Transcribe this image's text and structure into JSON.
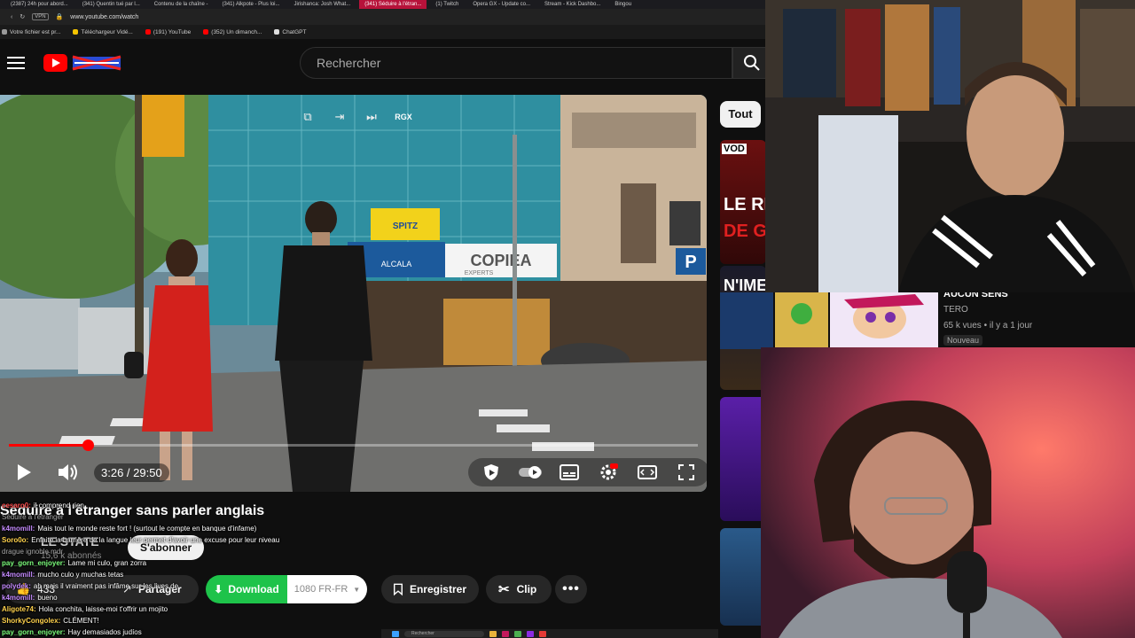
{
  "browser": {
    "tabs": [
      "(2387) 24h pour abord...",
      "(341) Quentin tué par l...",
      "Contenu de la chaîne -",
      "(341) Alkpote - Plus loi...",
      "Jirishanca: Josh What...",
      "(341) Séduire à l'étran...",
      "(1) Twitch",
      "Opera GX - Update co...",
      "Stream - Kick Dashbo...",
      "Bingou"
    ],
    "active_tab": "(341) Séduire à l'étran...",
    "vpn_label": "VPN",
    "url": "www.youtube.com/watch",
    "bookmarks": [
      "Votre fichier est pr...",
      "Téléchargeur Vidé...",
      "(191) YouTube",
      "(352) Un dimanch...",
      "ChatGPT"
    ]
  },
  "header": {
    "search_placeholder": "Rechercher"
  },
  "player": {
    "time_label": "3:26 / 29:50",
    "progress_fraction": 0.115,
    "rgx_label": "RGX",
    "scene_signs": {
      "spitz": "SPITZ",
      "copiea": "COPIEA",
      "experts": "EXPERTS",
      "parking": "P",
      "alcala": "ALCALA"
    }
  },
  "video": {
    "title": "Séduire à l'étranger sans parler anglais",
    "channel": "LE STATE",
    "subscribers": "15,6 k abonnés",
    "subscribe_label": "S'abonner",
    "like_count": "433",
    "share_label": "Partager",
    "download_label": "Download",
    "quality_label": "1080 FR-FR",
    "save_label": "Enregistrer",
    "clip_label": "Clip"
  },
  "chat": [
    {
      "user": "cesaro0:",
      "text": "il comprend rien",
      "color": "#ff4d4d"
    },
    {
      "user": "",
      "text": "Séduire à l'étranger",
      "color": "#ffffff"
    },
    {
      "user": "k4momill:",
      "text": "Mais tout le monde reste fort ! (surtout le compte en banque d'infame)",
      "color": "#c58bff"
    },
    {
      "user": "Soro0o:",
      "text": "Enfaite la barrière de la langue leur permet d'avoir une excuse pour leur niveau",
      "color": "#ffd24d"
    },
    {
      "user": "",
      "text": "drague ignoble mdr",
      "color": "#ffffff"
    },
    {
      "user": "pay_gorn_enjoyer:",
      "text": "Lame mi culo, gran zorra",
      "color": "#7dff7d"
    },
    {
      "user": "k4momill:",
      "text": "mucho culo y muchas tetas",
      "color": "#c58bff"
    },
    {
      "user": "polydek:",
      "text": "ah mais il vraiment pas infâme sur les lives de",
      "color": "#c58bff"
    },
    {
      "user": "k4momill:",
      "text": "bueno",
      "color": "#c58bff"
    },
    {
      "user": "Aligote74:",
      "text": "Hola conchita, laisse-moi t'offrir un mojito",
      "color": "#ffd24d"
    },
    {
      "user": "ShorkyCongolex:",
      "text": "CLÉMENT!",
      "color": "#ffd24d"
    },
    {
      "user": "pay_gorn_enjoyer:",
      "text": "Hay demasiados judíos",
      "color": "#7dff7d"
    }
  ],
  "related": {
    "chip_all": "Tout",
    "thumb_labels": [
      "VOD",
      "LE RET",
      "DE GA",
      "N'IME"
    ],
    "item_title": "AUCUN SENS",
    "item_channel": "TERO",
    "item_meta": "65 k vues • il y a 1 jour",
    "item_badge": "Nouveau"
  },
  "taskbar": {
    "search_placeholder": "Rechercher"
  },
  "colors": {
    "brand_red": "#ff0000",
    "download_green": "#1ec34a",
    "active_tab": "#b7123a"
  }
}
